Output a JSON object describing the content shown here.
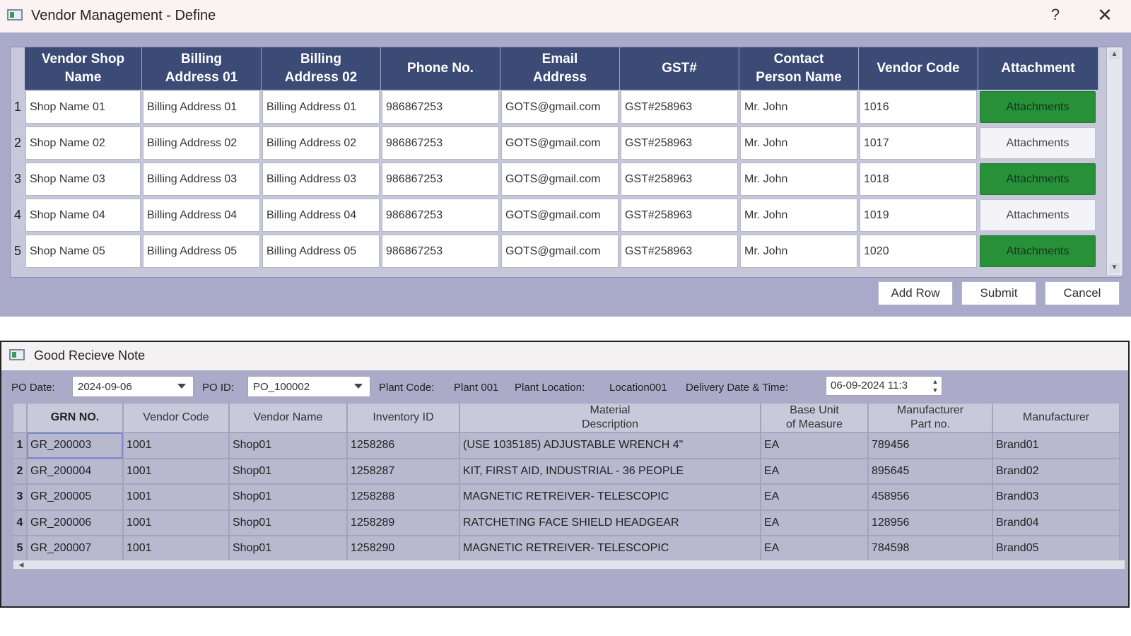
{
  "vendor_window": {
    "title": "Vendor Management - Define",
    "help": "?",
    "close": "✕",
    "columns": [
      "Vendor Shop\nName",
      "Billing\nAddress 01",
      "Billing\nAddress 02",
      "Phone No.",
      "Email\nAddress",
      "GST#",
      "Contact\nPerson Name",
      "Vendor Code",
      "Attachment"
    ],
    "rows": [
      {
        "num": "1",
        "shop": "Shop Name 01",
        "bill1": "Billing Address 01",
        "bill2": "Billing Address 01",
        "phone": "986867253",
        "email": "GOTS@gmail.com",
        "gst": "GST#258963",
        "contact": "Mr. John",
        "code": "1016",
        "attachment": "Attachments",
        "attachment_state": "green"
      },
      {
        "num": "2",
        "shop": "Shop Name 02",
        "bill1": "Billing Address 02",
        "bill2": "Billing Address 02",
        "phone": "986867253",
        "email": "GOTS@gmail.com",
        "gst": "GST#258963",
        "contact": "Mr. John",
        "code": "1017",
        "attachment": "Attachments",
        "attachment_state": "white"
      },
      {
        "num": "3",
        "shop": "Shop Name 03",
        "bill1": "Billing Address 03",
        "bill2": "Billing Address 03",
        "phone": "986867253",
        "email": "GOTS@gmail.com",
        "gst": "GST#258963",
        "contact": "Mr. John",
        "code": "1018",
        "attachment": "Attachments",
        "attachment_state": "green"
      },
      {
        "num": "4",
        "shop": "Shop Name 04",
        "bill1": "Billing Address 04",
        "bill2": "Billing Address 04",
        "phone": "986867253",
        "email": "GOTS@gmail.com",
        "gst": "GST#258963",
        "contact": "Mr. John",
        "code": "1019",
        "attachment": "Attachments",
        "attachment_state": "white"
      },
      {
        "num": "5",
        "shop": "Shop Name 05",
        "bill1": "Billing Address 05",
        "bill2": "Billing Address 05",
        "phone": "986867253",
        "email": "GOTS@gmail.com",
        "gst": "GST#258963",
        "contact": "Mr. John",
        "code": "1020",
        "attachment": "Attachments",
        "attachment_state": "green"
      }
    ],
    "buttons": {
      "add_row": "Add Row",
      "submit": "Submit",
      "cancel": "Cancel"
    },
    "colors": {
      "header_bg": "#3c4b75",
      "attachment_green": "#27913a",
      "window_bg": "#a9a9ca"
    }
  },
  "grn_window": {
    "title": "Good Recieve Note",
    "filters": {
      "po_date_label": "PO Date:",
      "po_date_value": "2024-09-06",
      "po_id_label": "PO ID:",
      "po_id_value": "PO_100002",
      "plant_code_label": "Plant Code:",
      "plant_code_value": "Plant 001",
      "plant_location_label": "Plant Location:",
      "plant_location_value": "Location001",
      "delivery_label": "Delivery Date & Time:",
      "delivery_value": "06-09-2024 11:3"
    },
    "columns": [
      "GRN NO.",
      "Vendor Code",
      "Vendor Name",
      "Inventory ID",
      "Material\nDescription",
      "Base Unit\nof Measure",
      "Manufacturer\nPart no.",
      "Manufacturer"
    ],
    "rows": [
      {
        "num": "1",
        "grn": "GR_200003",
        "vcode": "1001",
        "vname": "Shop01",
        "inv": "1258286",
        "desc": "(USE 1035185) ADJUSTABLE WRENCH 4\"",
        "uom": "EA",
        "part": "789456",
        "mfr": "Brand01"
      },
      {
        "num": "2",
        "grn": "GR_200004",
        "vcode": "1001",
        "vname": "Shop01",
        "inv": "1258287",
        "desc": "KIT, FIRST AID, INDUSTRIAL - 36 PEOPLE",
        "uom": "EA",
        "part": "895645",
        "mfr": "Brand02"
      },
      {
        "num": "3",
        "grn": "GR_200005",
        "vcode": "1001",
        "vname": "Shop01",
        "inv": "1258288",
        "desc": "MAGNETIC RETREIVER- TELESCOPIC",
        "uom": "EA",
        "part": "458956",
        "mfr": "Brand03"
      },
      {
        "num": "4",
        "grn": "GR_200006",
        "vcode": "1001",
        "vname": "Shop01",
        "inv": "1258289",
        "desc": "RATCHETING FACE SHIELD HEADGEAR",
        "uom": "EA",
        "part": "128956",
        "mfr": "Brand04"
      },
      {
        "num": "5",
        "grn": "GR_200007",
        "vcode": "1001",
        "vname": "Shop01",
        "inv": "1258290",
        "desc": "MAGNETIC RETREIVER- TELESCOPIC",
        "uom": "EA",
        "part": "784598",
        "mfr": "Brand05"
      }
    ]
  }
}
